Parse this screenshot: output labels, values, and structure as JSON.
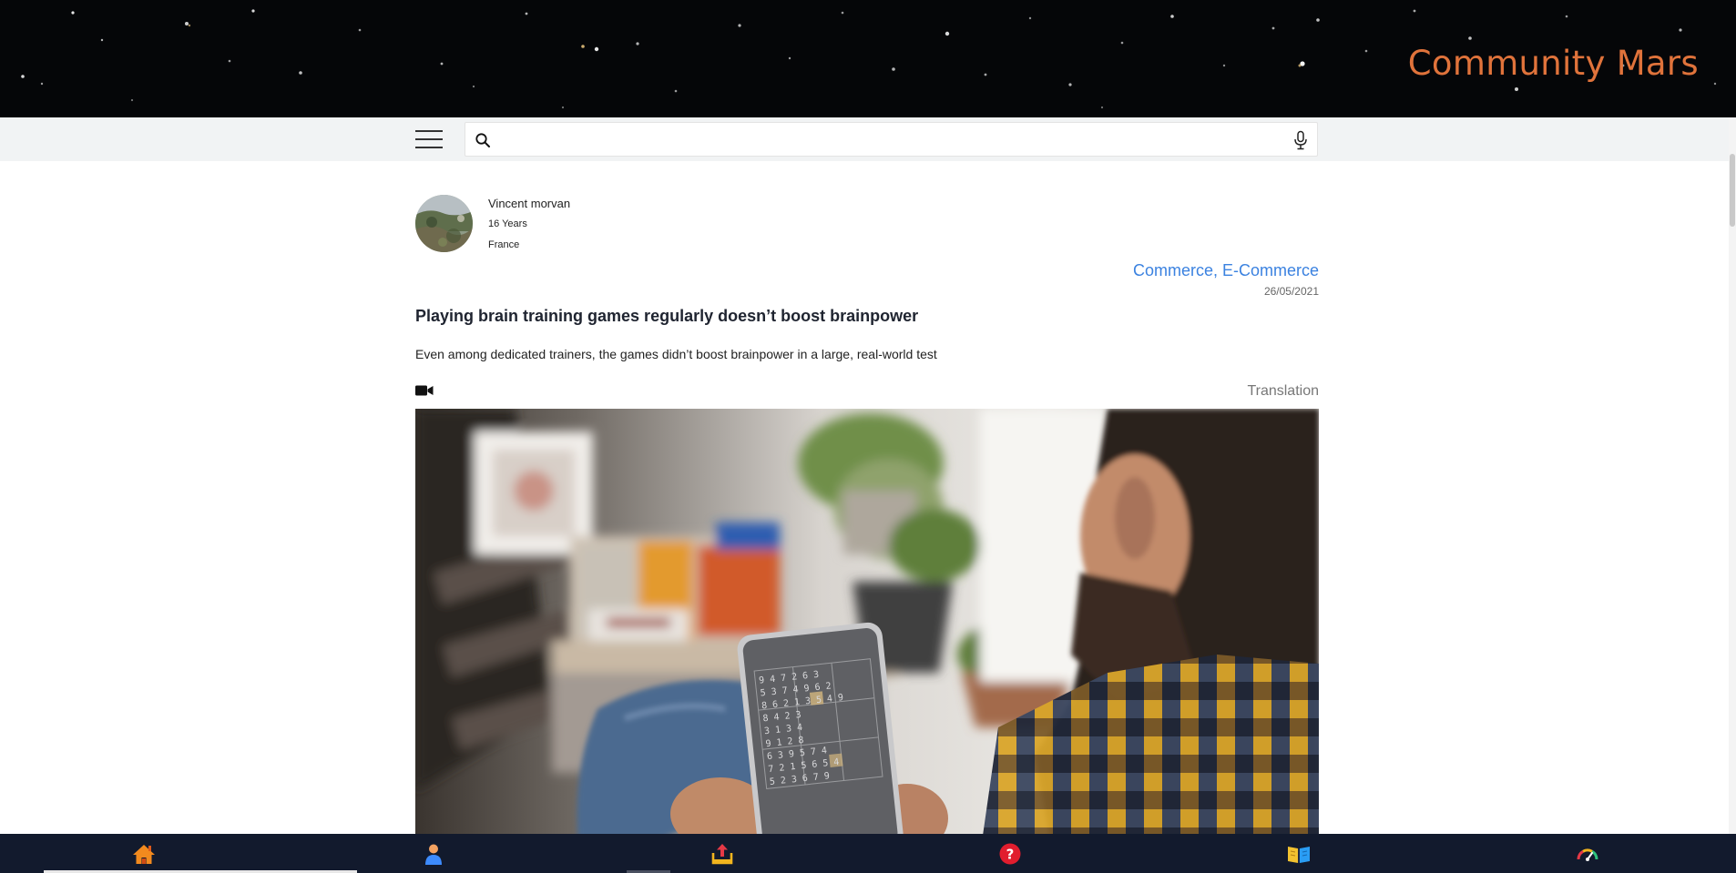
{
  "brand": {
    "title": "Community Mars"
  },
  "search": {
    "placeholder": "",
    "value": ""
  },
  "post": {
    "author": {
      "name": "Vincent morvan",
      "age": "16 Years",
      "country": "France"
    },
    "category": "Commerce, E-Commerce",
    "date": "26/05/2021",
    "title": "Playing brain training games regularly doesn’t boost brainpower",
    "summary": "Even among dedicated trainers, the games didn’t boost brainpower in a large, real-world test",
    "translation_label": "Translation",
    "media_type_icon": "video-camera-icon"
  },
  "bottom_nav": {
    "items": [
      {
        "icon": "home-icon",
        "active": true
      },
      {
        "icon": "profile-icon",
        "active": false
      },
      {
        "icon": "upload-icon",
        "active": false
      },
      {
        "icon": "help-icon",
        "active": false
      },
      {
        "icon": "book-icon",
        "active": false
      },
      {
        "icon": "gauge-icon",
        "active": false
      }
    ]
  },
  "colors": {
    "brand": "#e0733b",
    "category_link": "#3b82e0",
    "bottom_nav_bg": "#121a2d",
    "header_bg": "#050608"
  }
}
